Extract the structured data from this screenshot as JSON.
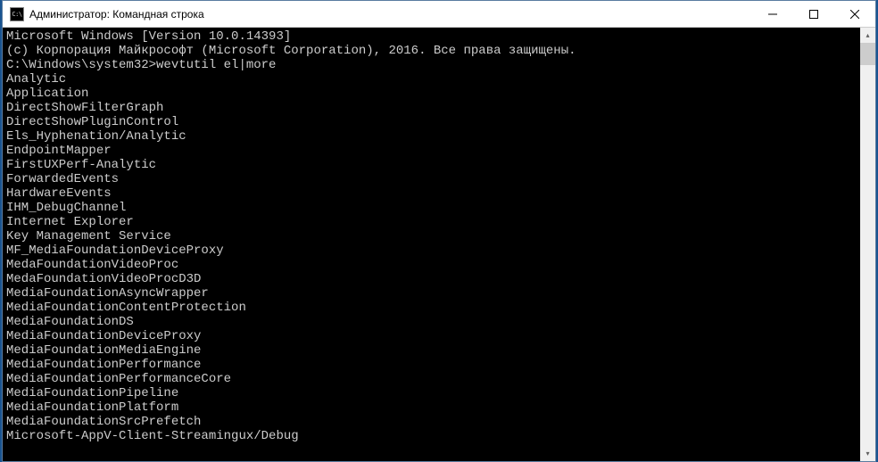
{
  "window": {
    "icon_text": "C:\\",
    "title": "Администратор: Командная строка"
  },
  "terminal": {
    "header1": "Microsoft Windows [Version 10.0.14393]",
    "header2": "(c) Корпорация Майкрософт (Microsoft Corporation), 2016. Все права защищены.",
    "blank": "",
    "prompt": "C:\\Windows\\system32>wevtutil el|more",
    "lines": [
      "Analytic",
      "Application",
      "DirectShowFilterGraph",
      "DirectShowPluginControl",
      "Els_Hyphenation/Analytic",
      "EndpointMapper",
      "FirstUXPerf-Analytic",
      "ForwardedEvents",
      "HardwareEvents",
      "IHM_DebugChannel",
      "Internet Explorer",
      "Key Management Service",
      "MF_MediaFoundationDeviceProxy",
      "MedaFoundationVideoProc",
      "MedaFoundationVideoProcD3D",
      "MediaFoundationAsyncWrapper",
      "MediaFoundationContentProtection",
      "MediaFoundationDS",
      "MediaFoundationDeviceProxy",
      "MediaFoundationMediaEngine",
      "MediaFoundationPerformance",
      "MediaFoundationPerformanceCore",
      "MediaFoundationPipeline",
      "MediaFoundationPlatform",
      "MediaFoundationSrcPrefetch",
      "Microsoft-AppV-Client-Streamingux/Debug"
    ]
  }
}
